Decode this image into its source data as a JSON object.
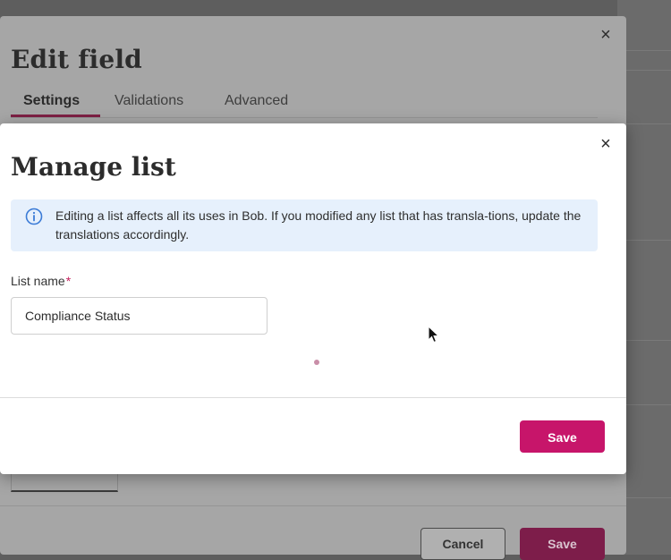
{
  "edit_field_dialog": {
    "title": "Edit field",
    "close_glyph": "×",
    "tabs": [
      {
        "label": "Settings",
        "active": true
      },
      {
        "label": "Validations",
        "active": false
      },
      {
        "label": "Advanced",
        "active": false
      }
    ],
    "cancel_label": "Cancel",
    "save_label": "Save"
  },
  "manage_list_dialog": {
    "title": "Manage list",
    "close_glyph": "×",
    "info_banner": {
      "icon": "info-icon",
      "text": "Editing a list affects all its uses in Bob. If you modified any list that has transla-tions, update the translations accordingly."
    },
    "list_name": {
      "label": "List name",
      "required_mark": "*",
      "value": "Compliance Status"
    },
    "save_label": "Save"
  },
  "colors": {
    "accent": "#c7156a",
    "info_background": "#e6f0fc",
    "info_icon": "#3b7bd6"
  }
}
